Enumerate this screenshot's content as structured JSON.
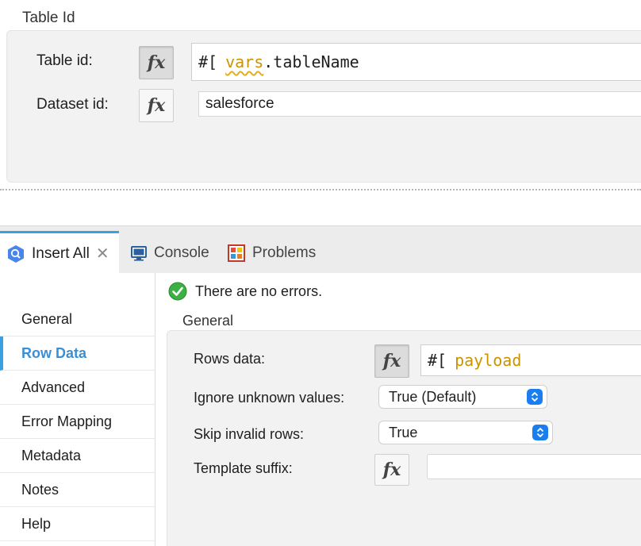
{
  "top_section": {
    "title": "Table Id",
    "table_id": {
      "label": "Table id:",
      "expr_prefix": "#[",
      "expr_var": "vars",
      "expr_rest": ".tableName"
    },
    "dataset_id": {
      "label": "Dataset id:",
      "value": "salesforce"
    }
  },
  "tabs": [
    {
      "label": "Insert All",
      "icon": "bigquery-icon",
      "active": true,
      "closable": true
    },
    {
      "label": "Console",
      "icon": "console-icon",
      "active": false
    },
    {
      "label": "Problems",
      "icon": "problems-icon",
      "active": false
    }
  ],
  "nav": {
    "items": [
      {
        "label": "General"
      },
      {
        "label": "Row Data",
        "active": true
      },
      {
        "label": "Advanced"
      },
      {
        "label": "Error Mapping"
      },
      {
        "label": "Metadata"
      },
      {
        "label": "Notes"
      },
      {
        "label": "Help"
      }
    ]
  },
  "content": {
    "status": "There are no errors.",
    "section_title": "General",
    "rows_data": {
      "label": "Rows data:",
      "expr_prefix": "#[",
      "expr_value": "payload"
    },
    "ignore_unknown": {
      "label": "Ignore unknown values:",
      "value": "True (Default)"
    },
    "skip_invalid": {
      "label": "Skip invalid rows:",
      "value": "True"
    },
    "template_suffix": {
      "label": "Template suffix:",
      "value": ""
    }
  },
  "icons": {
    "fx": "fx"
  },
  "colors": {
    "accent": "#3aa0e0",
    "active_nav_text": "#3b8fd4",
    "expression_keyword": "#c99400",
    "select_arrow": "#1a7ef0",
    "success": "#3cb043"
  }
}
